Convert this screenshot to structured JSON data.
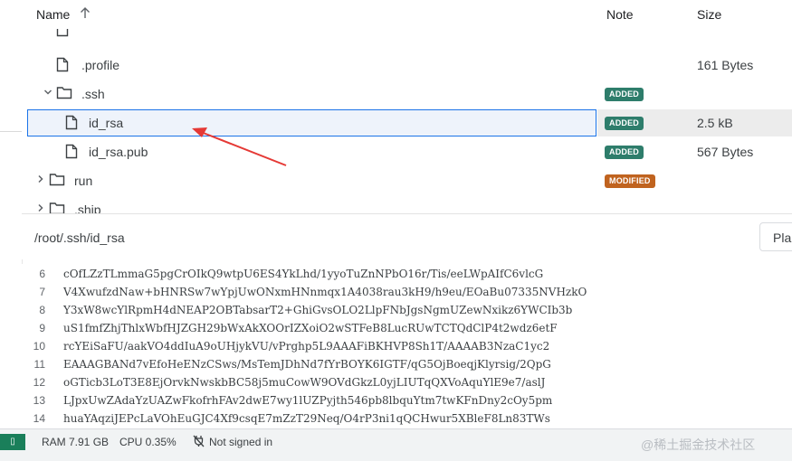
{
  "tree": {
    "headers": {
      "name": "Name",
      "note": "Note",
      "size": "Size"
    },
    "rows": [
      {
        "name": ".profile",
        "size": "161 Bytes",
        "note": ""
      },
      {
        "name": ".ssh",
        "note": "ADDED",
        "size": ""
      },
      {
        "name": "id_rsa",
        "note": "ADDED",
        "size": "2.5 kB"
      },
      {
        "name": "id_rsa.pub",
        "note": "ADDED",
        "size": "567 Bytes"
      },
      {
        "name": "run",
        "note": "MODIFIED",
        "size": ""
      },
      {
        "name": ".ship",
        "note": "",
        "size": ""
      }
    ]
  },
  "path_bar": {
    "path": "/root/.ssh/id_rsa",
    "button_label": "Pla"
  },
  "code": {
    "lines": [
      {
        "n": "6",
        "t": "cOfLZzTLmmaG5pgCrOIkQ9wtpU6ES4YkLhd/1yyoTuZnNPbO16r/Tis/eeLWpAIfC6vlcG"
      },
      {
        "n": "7",
        "t": "V4XwufzdNaw+bHNRSw7wYpjUwONxmHNnmqx1A4038rau3kH9/h9eu/EOaBu07335NVHzkO"
      },
      {
        "n": "8",
        "t": "Y3xW8wcYlRpmH4dNEAP2OBTabsarT2+GhiGvsOLO2LlpFNbJgsNgmUZewNxikz6YWCIb3b"
      },
      {
        "n": "9",
        "t": "uS1fmfZhjThlxWbfHJZGH29bWxAkXOOrIZXoiO2wSTFeB8LucRUwTCTQdClP4t2wdz6etF"
      },
      {
        "n": "10",
        "t": "rcYEiSaFU/aakVO4ddIuA9oUHjykVU/vPrghp5L9AAAFiBKHVP8Sh1T/AAAAB3NzaC1yc2"
      },
      {
        "n": "11",
        "t": "EAAAGBANd7vEfoHeENzCSws/MsTemJDhNd7fYrBOYK6IGTF/qG5OjBoeqjKlyrsig/2QpG"
      },
      {
        "n": "12",
        "t": "oGTicb3LoT3E8EjOrvkNwskbBC58j5muCowW9OVdGkzL0yjLIUTqQXVoAquYlE9e7/aslJ"
      },
      {
        "n": "13",
        "t": "LJpxUwZAdaYzUAZwFkofrhFAv2dwE7wy1lUZPyjth546pb8lbquYtm7twKFnDny2cOy5pm"
      },
      {
        "n": "14",
        "t": "huaYAqziJEPcLaVOhEuGJC4Xf9csqE7mZzT29Neq/O4rP3ni1qQCHwur5XBleF8Ln83TWs"
      }
    ]
  },
  "status": {
    "left_badge": "▯",
    "ram": "RAM 7.91 GB",
    "cpu": "CPU 0.35%",
    "signin": "Not signed in",
    "watermark": "@稀土掘金技术社区"
  },
  "icons": {
    "sort": "arrow-up-icon",
    "file": "file-icon",
    "folder": "folder-icon",
    "chevron_down": "chevron-down-icon",
    "chevron_right": "chevron-right-icon",
    "not_signed_in": "plug-off-icon"
  },
  "colors": {
    "added": "#2e7d6b",
    "modified": "#c0631f",
    "selection_border": "#1a73e8",
    "annotation_arrow": "#e53935"
  }
}
